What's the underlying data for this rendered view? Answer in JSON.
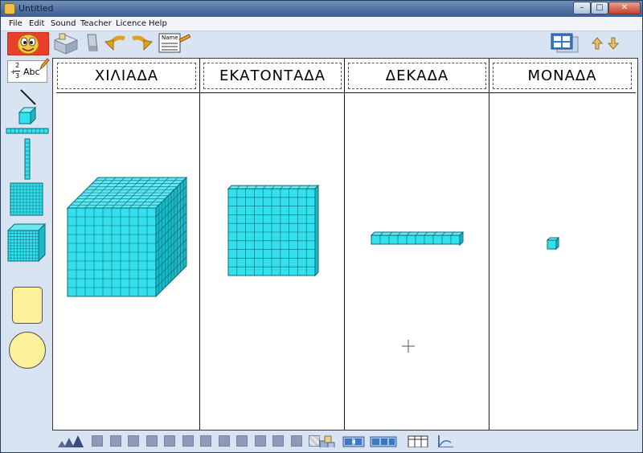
{
  "window": {
    "title": "Untitled",
    "controls": {
      "minimize": "–",
      "maximize": "□",
      "close": "✕"
    }
  },
  "menu": {
    "items": [
      "File",
      "Edit",
      "Sound",
      "Teacher",
      "Licence",
      "Help"
    ]
  },
  "toolbar": {
    "name_card_label": "Name",
    "icons": [
      "mascot-icon",
      "blocks-box-icon",
      "eraser-icon",
      "undo-icon",
      "redo-icon",
      "name-card-icon",
      "layout-view-icon",
      "arrow-up-icon",
      "arrow-down-icon"
    ]
  },
  "sidebar": {
    "label_tool_text": "Abc",
    "fraction_top": "2",
    "fraction_bottom": "3",
    "fraction_sign": "+",
    "tools": [
      "line-tool",
      "unit-cube-tool",
      "ten-rod-horizontal-tool",
      "ten-rod-vertical-tool",
      "hundred-flat-tool",
      "thousand-cube-tool",
      "yellow-square-tool",
      "yellow-circle-tool"
    ]
  },
  "board": {
    "columns": [
      {
        "id": "thousands",
        "header": "ΧΙΛΙΑΔΑ"
      },
      {
        "id": "hundreds",
        "header": "ΕΚΑΤΟΝΤΑΔΑ"
      },
      {
        "id": "tens",
        "header": "ΔΕΚΑΔΑ"
      },
      {
        "id": "ones",
        "header": "ΜΟΝΑΔΑ"
      }
    ],
    "blocks": [
      {
        "column": "thousands",
        "kind": "thousand-cube",
        "value": 1000
      },
      {
        "column": "hundreds",
        "kind": "hundred-flat",
        "value": 100
      },
      {
        "column": "tens",
        "kind": "ten-rod",
        "value": 10
      },
      {
        "column": "ones",
        "kind": "unit-cube",
        "value": 1
      }
    ]
  },
  "colors": {
    "block_fill": "#33e0ec",
    "block_side": "#1bb8c6",
    "block_line": "#0a6a78",
    "panel_bg": "#d9e4f2",
    "shape_yellow": "#fcf09a"
  },
  "bottombar": {
    "swatch_count": 13,
    "icons": [
      "zoom-triangles-icon",
      "blocks-stamp-icon",
      "regroup-left-icon",
      "regroup-right-icon",
      "columns-view-icon",
      "axis-icon"
    ]
  }
}
